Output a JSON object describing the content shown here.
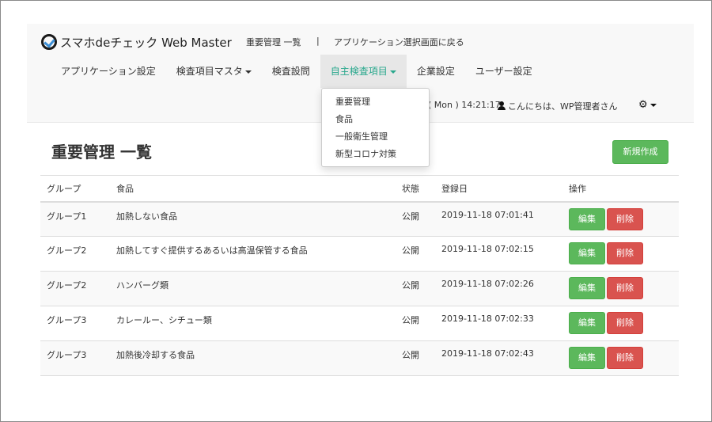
{
  "brand": {
    "name": "スマホdeチェック Web Master"
  },
  "header": {
    "crumb_current": "重要管理 一覧",
    "crumb_separator": "|",
    "back_link": "アプリケーション選択画面に戻る"
  },
  "nav": {
    "items": [
      {
        "label": "アプリケーション設定"
      },
      {
        "label": "検査項目マスタ"
      },
      {
        "label": "検査設問"
      },
      {
        "label": "自主検査項目"
      },
      {
        "label": "企業設定"
      },
      {
        "label": "ユーザー設定"
      }
    ]
  },
  "dropdown": {
    "items": [
      "重要管理",
      "食品",
      "一般衛生管理",
      "新型コロナ対策"
    ]
  },
  "status": {
    "datetime": "( Mon ) 14:21:17",
    "greeting": "こんにちは、WP管理者さん"
  },
  "page": {
    "title": "重要管理 一覧",
    "new_button": "新規作成"
  },
  "table": {
    "headers": [
      "グループ",
      "食品",
      "状態",
      "登録日",
      "操作"
    ],
    "rows": [
      {
        "group": "グループ1",
        "food": "加熱しない食品",
        "status": "公開",
        "date": "2019-11-18 07:01:41"
      },
      {
        "group": "グループ2",
        "food": "加熱してすぐ提供するあるいは高温保管する食品",
        "status": "公開",
        "date": "2019-11-18 07:02:15"
      },
      {
        "group": "グループ2",
        "food": "ハンバーグ類",
        "status": "公開",
        "date": "2019-11-18 07:02:26"
      },
      {
        "group": "グループ3",
        "food": "カレールー、シチュー類",
        "status": "公開",
        "date": "2019-11-18 07:02:33"
      },
      {
        "group": "グループ3",
        "food": "加熱後冷却する食品",
        "status": "公開",
        "date": "2019-11-18 07:02:43"
      }
    ],
    "edit_label": "編集",
    "delete_label": "削除"
  }
}
